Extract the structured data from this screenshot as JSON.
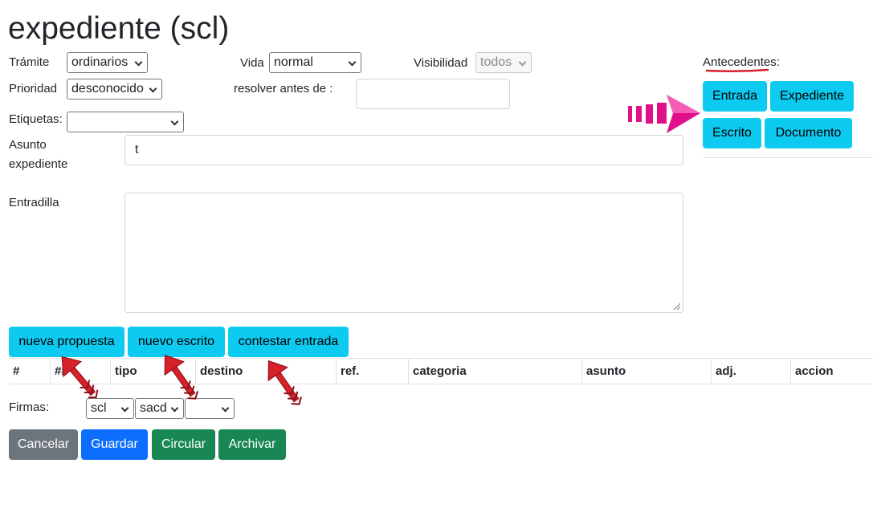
{
  "page": {
    "title": "expediente (scl)"
  },
  "form": {
    "tramite": {
      "label": "Trámite",
      "value": "ordinarios"
    },
    "vida": {
      "label": "Vida",
      "value": "normal"
    },
    "visibilidad": {
      "label": "Visibilidad",
      "value": "todos"
    },
    "prioridad": {
      "label": "Prioridad",
      "value": "desconocido"
    },
    "resolver": {
      "label": "resolver antes de :",
      "value": ""
    },
    "etiquetas": {
      "label": "Etiquetas:",
      "value": ""
    },
    "asunto": {
      "label_line1": "Asunto",
      "label_line2": "expediente",
      "value": "t"
    },
    "entradilla": {
      "label": "Entradilla",
      "value": ""
    }
  },
  "antecedentes": {
    "label": "Antecedentes:",
    "buttons": [
      "Entrada",
      "Expediente",
      "Escrito",
      "Documento"
    ]
  },
  "actions": [
    "nueva propuesta",
    "nuevo escrito",
    "contestar entrada"
  ],
  "table": {
    "headers": [
      "#",
      "##",
      "tipo",
      "destino",
      "ref.",
      "categoria",
      "asunto",
      "adj.",
      "accion"
    ]
  },
  "firmas": {
    "label": "Firmas:",
    "selects": [
      "scl",
      "sacd",
      ""
    ]
  },
  "footer_buttons": [
    "Cancelar",
    "Guardar",
    "Circular",
    "Archivar"
  ],
  "colors": {
    "info": "#0dcaf0",
    "secondary": "#6c757d",
    "primary": "#0d6efd",
    "success": "#198754",
    "annotation_arrow": "#d8202a",
    "annotation_magenta": "#e0108a"
  },
  "icons": {
    "select": "chevron-down-icon",
    "textarea": "resize-handle-icon",
    "annotations": "red-arrow-icon"
  }
}
